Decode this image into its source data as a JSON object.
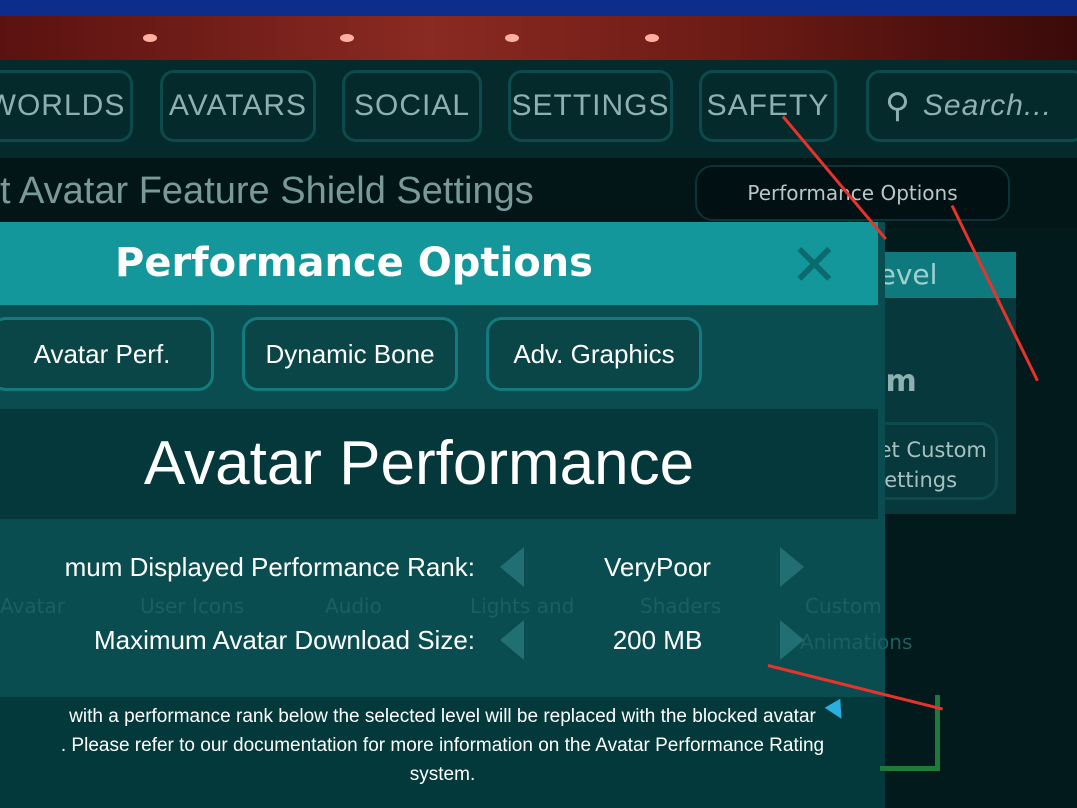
{
  "nav": {
    "items": [
      {
        "label": "WORLDS"
      },
      {
        "label": "AVATARS"
      },
      {
        "label": "SOCIAL"
      },
      {
        "label": "SETTINGS"
      },
      {
        "label": "SAFETY"
      }
    ],
    "search_placeholder": "Search..."
  },
  "page": {
    "title": "t Avatar Feature Shield Settings",
    "performance_options_button": "Performance Options"
  },
  "background_panel": {
    "header": "Shield Level",
    "level": "Custom",
    "reset_button": "Reset Custom Settings",
    "ghost_labels": [
      "Avatar",
      "User Icons",
      "Audio",
      "Lights and",
      "Shaders",
      "Custom",
      "Animations"
    ]
  },
  "modal": {
    "title": "Performance Options",
    "tabs": [
      {
        "label": "Avatar Perf."
      },
      {
        "label": "Dynamic Bone"
      },
      {
        "label": "Adv. Graphics"
      }
    ],
    "section_title": "Avatar Performance",
    "settings": [
      {
        "label": "mum Displayed Performance Rank:",
        "value": "VeryPoor"
      },
      {
        "label": "Maximum Avatar Download Size:",
        "value": "200 MB"
      }
    ],
    "description": [
      "with a performance rank below the selected level will be replaced with the blocked avatar",
      ". Please refer to our documentation for more information on the Avatar Performance Rating",
      "system."
    ]
  },
  "colors": {
    "modal_header": "#13979b",
    "modal_body": "#0a4d50",
    "annotation": "#e8332b"
  }
}
